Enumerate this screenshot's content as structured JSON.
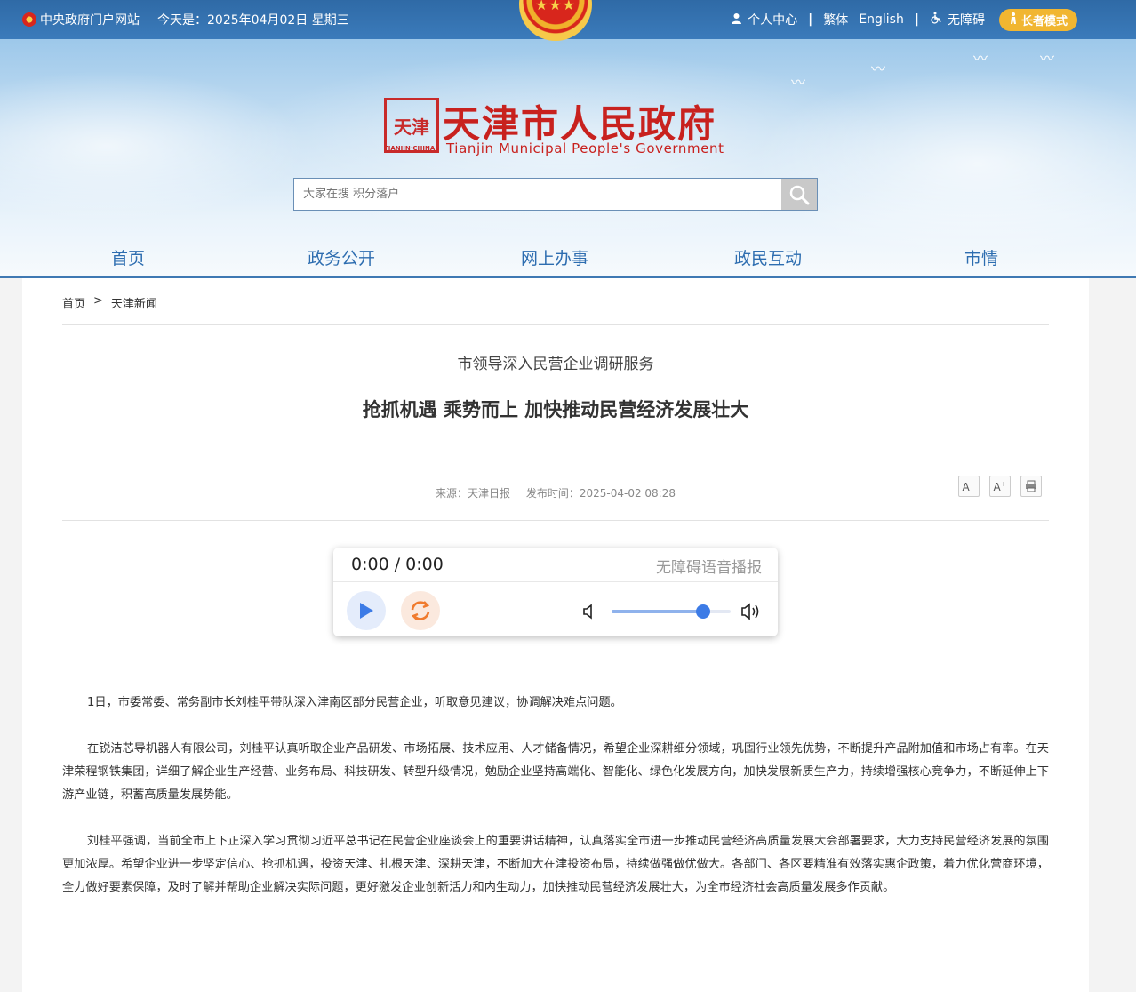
{
  "topbar": {
    "gov_portal": "中央政府门户网站",
    "date": "今天是：2025年04月02日 星期三",
    "personal_center": "个人中心",
    "traditional": "繁体",
    "english": "English",
    "accessibility": "无障碍",
    "elder_mode": "长者模式",
    "separator": "|"
  },
  "header": {
    "title_cn": "天津市人民政府",
    "title_en": "Tianjin Municipal People's Government",
    "seal_text": "天津",
    "seal_sub": "TIANJIN·CHINA",
    "search_placeholder": "大家在搜 积分落户"
  },
  "nav": [
    {
      "label": "首页"
    },
    {
      "label": "政务公开"
    },
    {
      "label": "网上办事"
    },
    {
      "label": "政民互动"
    },
    {
      "label": "市情"
    }
  ],
  "breadcrumb": {
    "home": "首页",
    "sep": ">",
    "current": "天津新闻"
  },
  "article": {
    "subtitle": "市领导深入民营企业调研服务",
    "title": "抢抓机遇 乘势而上 加快推动民营经济发展壮大",
    "source": "来源：天津日报",
    "publish_time": "发布时间：2025-04-02 08:28",
    "paragraphs": [
      "1日，市委常委、常务副市长刘桂平带队深入津南区部分民营企业，听取意见建议，协调解决难点问题。",
      "在锐洁芯导机器人有限公司，刘桂平认真听取企业产品研发、市场拓展、技术应用、人才储备情况，希望企业深耕细分领域，巩固行业领先优势，不断提升产品附加值和市场占有率。在天津荣程钢铁集团，详细了解企业生产经营、业务布局、科技研发、转型升级情况，勉励企业坚持高端化、智能化、绿色化发展方向，加快发展新质生产力，持续增强核心竞争力，不断延伸上下游产业链，积蓄高质量发展势能。",
      "刘桂平强调，当前全市上下正深入学习贯彻习近平总书记在民营企业座谈会上的重要讲话精神，认真落实全市进一步推动民营经济高质量发展大会部署要求，大力支持民营经济发展的氛围更加浓厚。希望企业进一步坚定信心、抢抓机遇，投资天津、扎根天津、深耕天津，不断加大在津投资布局，持续做强做优做大。各部门、各区要精准有效落实惠企政策，着力优化营商环境，全力做好要素保障，及时了解并帮助企业解决实际问题，更好激发企业创新活力和内生动力，加快推动民营经济发展壮大，为全市经济社会高质量发展多作贡献。"
    ]
  },
  "player": {
    "time": "0:00 / 0:00",
    "label": "无障碍语音播报",
    "volume_fraction": 0.77
  },
  "colors": {
    "topbar": "#3b7bbb",
    "title_red": "#c8211e",
    "nav_blue": "#2d6db0",
    "elder_gold": "#f1b631"
  }
}
